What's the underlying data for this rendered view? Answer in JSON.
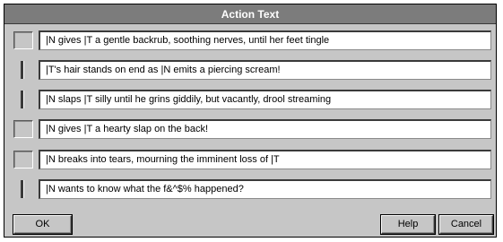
{
  "dialog": {
    "title": "Action Text",
    "rows": [
      {
        "text": "|N gives |T a gentle backrub, soothing nerves, until her feet tingle",
        "boxed": true
      },
      {
        "text": "|T's hair stands on end as |N emits a piercing scream!",
        "boxed": false
      },
      {
        "text": "|N slaps |T silly until he grins giddily, but vacantly, drool streaming",
        "boxed": false
      },
      {
        "text": "|N gives |T a hearty slap on the back!",
        "boxed": true
      },
      {
        "text": "|N breaks into tears, mourning the imminent loss of |T",
        "boxed": true
      },
      {
        "text": "|N wants to know what the f&^$% happened?",
        "boxed": false
      }
    ],
    "buttons": {
      "ok": "OK",
      "help": "Help",
      "cancel": "Cancel"
    }
  }
}
